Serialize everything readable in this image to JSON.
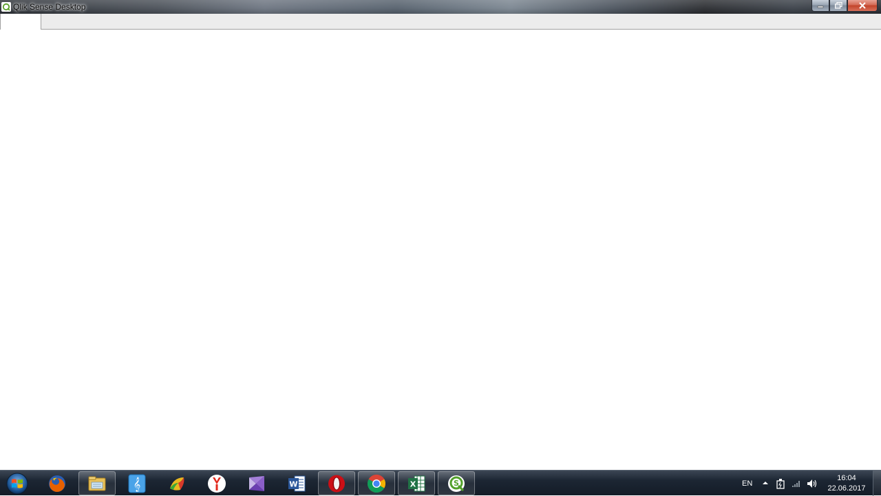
{
  "window": {
    "title": "Qlik Sense Desktop",
    "icon": "qlik-sense-icon",
    "controls": [
      "minimize",
      "maximize",
      "close"
    ]
  },
  "tabs": [
    {
      "label": ""
    }
  ],
  "taskbar": {
    "pinned": [
      {
        "name": "firefox-icon",
        "active": false
      },
      {
        "name": "file-explorer-icon",
        "active": true
      },
      {
        "name": "music-app-icon",
        "active": false
      },
      {
        "name": "colorful-app-icon",
        "active": false
      },
      {
        "name": "yandex-browser-icon",
        "active": false
      },
      {
        "name": "visual-studio-icon",
        "active": false
      },
      {
        "name": "word-icon",
        "active": false
      },
      {
        "name": "opera-icon",
        "active": true
      },
      {
        "name": "chrome-icon",
        "active": true
      },
      {
        "name": "excel-icon",
        "active": true
      },
      {
        "name": "qlik-sense-icon",
        "active": true
      }
    ],
    "language": "EN",
    "clock": {
      "time": "16:04",
      "date": "22.06.2017"
    },
    "colors": {
      "accent": "#1c2633"
    }
  }
}
